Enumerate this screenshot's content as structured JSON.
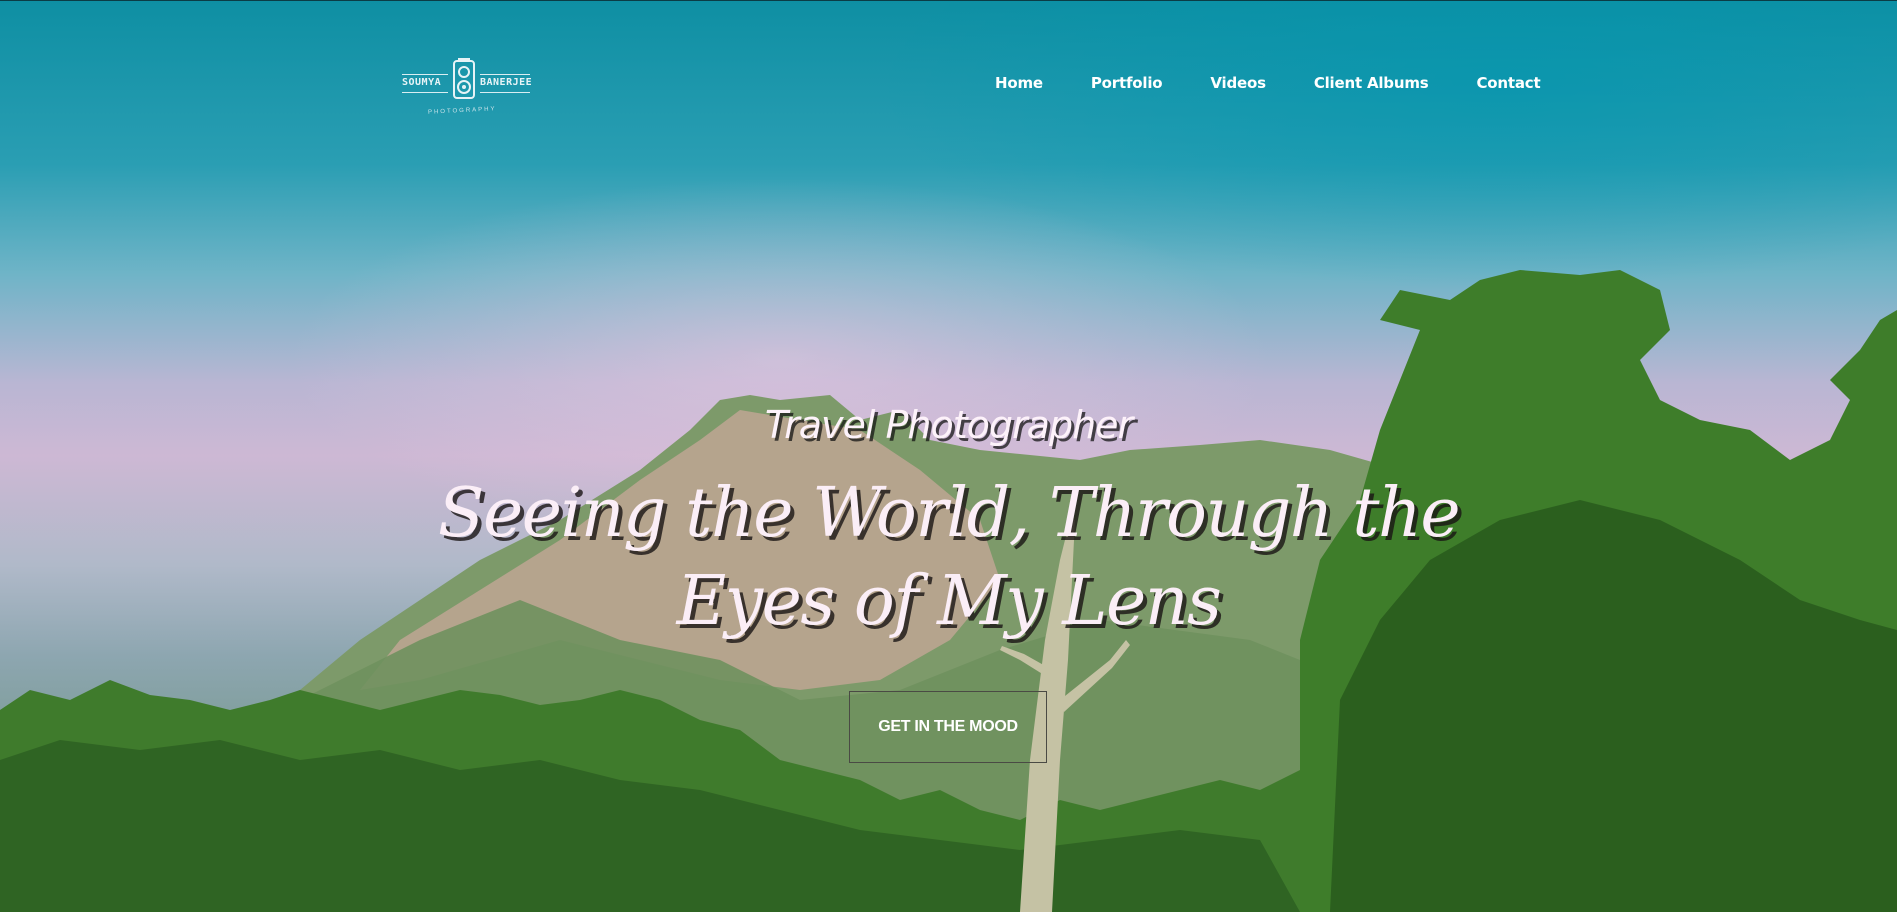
{
  "brand": {
    "name_left": "SOUMYA",
    "name_right": "BANERJEE",
    "tagline": "PHOTOGRAPHY"
  },
  "nav": {
    "items": [
      {
        "label": "Home"
      },
      {
        "label": "Portfolio"
      },
      {
        "label": "Videos"
      },
      {
        "label": "Client Albums"
      },
      {
        "label": "Contact"
      }
    ]
  },
  "hero": {
    "eyebrow": "Travel Photographer",
    "headline_line1": "Seeing the World, Through the",
    "headline_line2": "Eyes of My Lens",
    "cta_label": "GET IN THE MOOD",
    "background_image": "mountain-and-forest-photo"
  },
  "colors": {
    "sky_top": "#0e8fa3",
    "sky_glow": "#cdb8d4",
    "text": "#ffffff",
    "foliage": "#3d7a2a"
  }
}
